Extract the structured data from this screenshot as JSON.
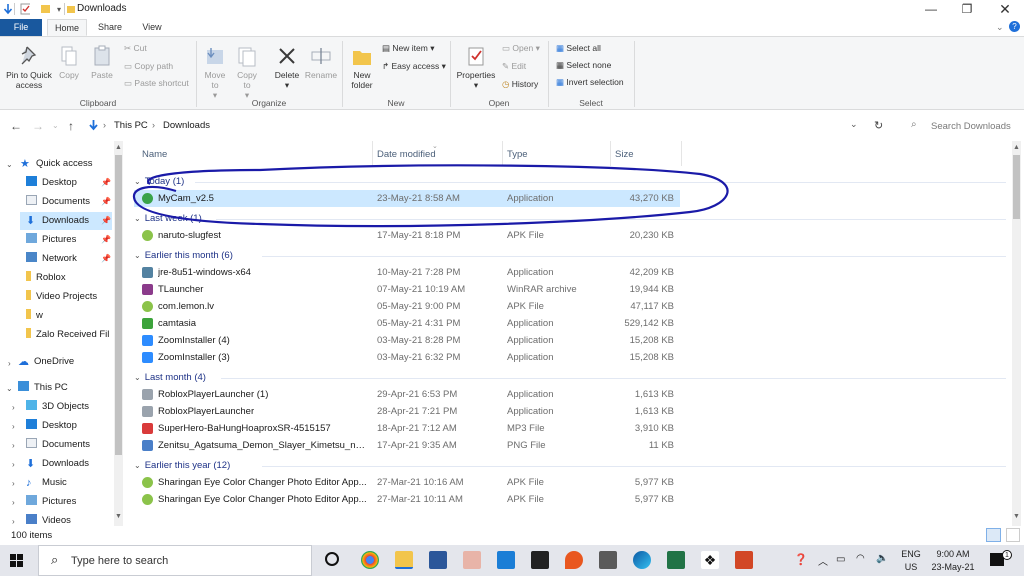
{
  "window": {
    "title": "Downloads"
  },
  "ribbon_tabs": [
    "File",
    "Home",
    "Share",
    "View"
  ],
  "ribbon": {
    "clipboard": {
      "pin": "Pin to Quick access",
      "copy": "Copy",
      "paste": "Paste",
      "cut": "Cut",
      "copy_path": "Copy path",
      "paste_shortcut": "Paste shortcut",
      "group": "Clipboard"
    },
    "organize": {
      "move_to": "Move to",
      "copy_to": "Copy to",
      "delete": "Delete",
      "rename": "Rename",
      "group": "Organize"
    },
    "new": {
      "new_folder": "New folder",
      "new_item": "New item",
      "easy_access": "Easy access",
      "group": "New"
    },
    "open": {
      "properties": "Properties",
      "open": "Open",
      "edit": "Edit",
      "history": "History",
      "group": "Open"
    },
    "select": {
      "select_all": "Select all",
      "select_none": "Select none",
      "invert": "Invert selection",
      "group": "Select"
    }
  },
  "address": {
    "crumbs": [
      "This PC",
      "Downloads"
    ],
    "search_placeholder": "Search Downloads"
  },
  "nav": {
    "quick_access": "Quick access",
    "quick_items": [
      {
        "label": "Desktop",
        "pinned": true
      },
      {
        "label": "Documents",
        "pinned": true
      },
      {
        "label": "Downloads",
        "pinned": true,
        "selected": true
      },
      {
        "label": "Pictures",
        "pinned": true
      },
      {
        "label": "Network",
        "pinned": true
      },
      {
        "label": "Roblox"
      },
      {
        "label": "Video Projects"
      },
      {
        "label": "w"
      },
      {
        "label": "Zalo Received Fil"
      }
    ],
    "onedrive": "OneDrive",
    "this_pc": "This PC",
    "pc_items": [
      "3D Objects",
      "Desktop",
      "Documents",
      "Downloads",
      "Music",
      "Pictures",
      "Videos"
    ]
  },
  "columns": {
    "name": "Name",
    "date": "Date modified",
    "type": "Type",
    "size": "Size"
  },
  "groups": [
    {
      "label": "Today (1)",
      "files": [
        {
          "name": "MyCam_v2.5",
          "date": "23-May-21 8:58 AM",
          "type": "Application",
          "size": "43,270 KB",
          "selected": true,
          "icon": "app-green"
        }
      ]
    },
    {
      "label": "Last week (1)",
      "files": [
        {
          "name": "naruto-slugfest",
          "date": "17-May-21 8:18 PM",
          "type": "APK File",
          "size": "20,230 KB",
          "icon": "apk"
        }
      ]
    },
    {
      "label": "Earlier this month (6)",
      "files": [
        {
          "name": "jre-8u51-windows-x64",
          "date": "10-May-21 7:28 PM",
          "type": "Application",
          "size": "42,209 KB",
          "icon": "java"
        },
        {
          "name": "TLauncher",
          "date": "07-May-21 10:19 AM",
          "type": "WinRAR archive",
          "size": "19,944 KB",
          "icon": "rar"
        },
        {
          "name": "com.lemon.lv",
          "date": "05-May-21 9:00 PM",
          "type": "APK File",
          "size": "47,117 KB",
          "icon": "apk"
        },
        {
          "name": "camtasia",
          "date": "05-May-21 4:31 PM",
          "type": "Application",
          "size": "529,142 KB",
          "icon": "camtasia"
        },
        {
          "name": "ZoomInstaller (4)",
          "date": "03-May-21 8:28 PM",
          "type": "Application",
          "size": "15,208 KB",
          "icon": "zoom"
        },
        {
          "name": "ZoomInstaller (3)",
          "date": "03-May-21 6:32 PM",
          "type": "Application",
          "size": "15,208 KB",
          "icon": "zoom"
        }
      ]
    },
    {
      "label": "Last month (4)",
      "files": [
        {
          "name": "RobloxPlayerLauncher (1)",
          "date": "29-Apr-21 6:53 PM",
          "type": "Application",
          "size": "1,613 KB",
          "icon": "roblox"
        },
        {
          "name": "RobloxPlayerLauncher",
          "date": "28-Apr-21 7:21 PM",
          "type": "Application",
          "size": "1,613 KB",
          "icon": "roblox"
        },
        {
          "name": "SuperHero-BaHungHoaproxSR-4515157",
          "date": "18-Apr-21 7:12 AM",
          "type": "MP3 File",
          "size": "3,910 KB",
          "icon": "mp3"
        },
        {
          "name": "Zenitsu_Agatsuma_Demon_Slayer_Kimetsu_no_...",
          "date": "17-Apr-21 9:35 AM",
          "type": "PNG File",
          "size": "11 KB",
          "icon": "png"
        }
      ]
    },
    {
      "label": "Earlier this year (12)",
      "files": [
        {
          "name": "Sharingan Eye Color Changer Photo Editor App...",
          "date": "27-Mar-21 10:16 AM",
          "type": "APK File",
          "size": "5,977 KB",
          "icon": "apk"
        },
        {
          "name": "Sharingan Eye Color Changer Photo Editor App...",
          "date": "27-Mar-21 10:11 AM",
          "type": "APK File",
          "size": "5,977 KB",
          "icon": "apk"
        }
      ]
    }
  ],
  "status": {
    "count": "100 items"
  },
  "taskbar": {
    "search_placeholder": "Type here to search",
    "lang": "ENG",
    "region": "US",
    "time": "9:00 AM",
    "date": "23-May-21",
    "notif_count": "1"
  },
  "annotation": {
    "color": "#1a1aa8"
  }
}
